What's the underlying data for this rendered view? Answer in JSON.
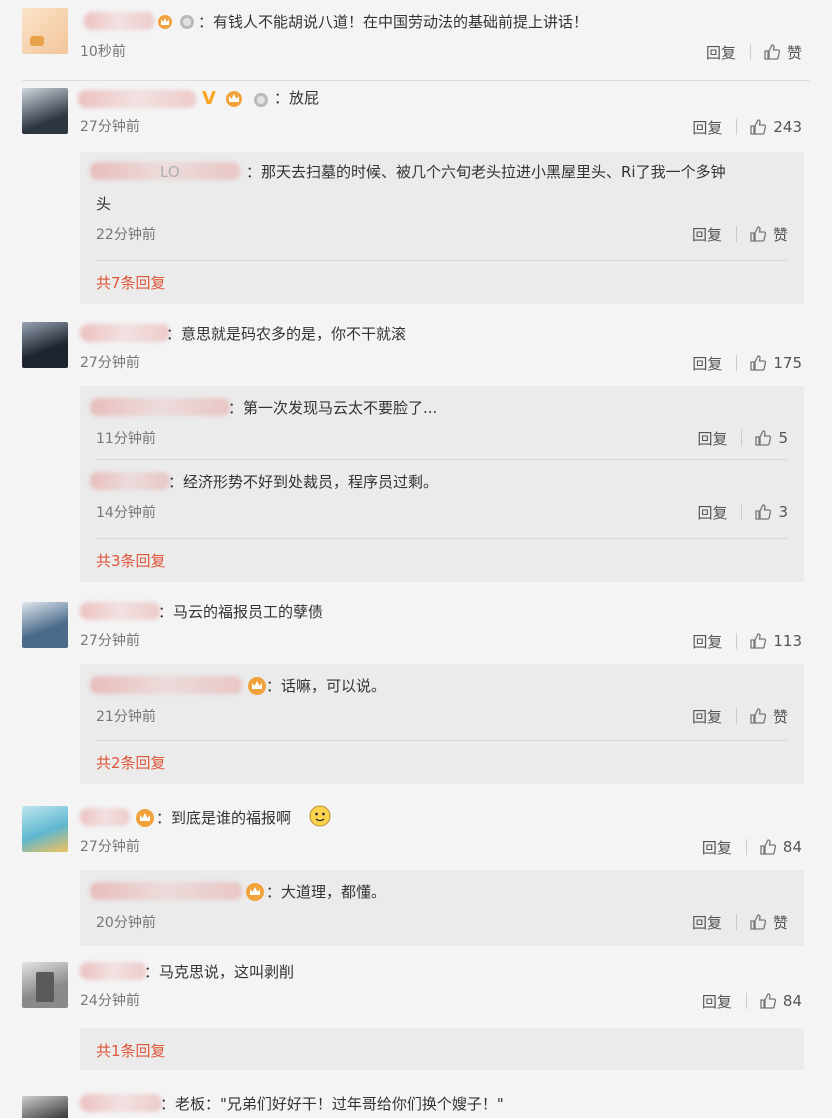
{
  "ui": {
    "reply_label": "回复",
    "like_label": "赞"
  },
  "comments": [
    {
      "text": "：有钱人不能胡说八道！在中国劳动法的基础前提上讲话！",
      "time": "10秒前",
      "likes": "赞"
    },
    {
      "text": "：放屁",
      "time": "27分钟前",
      "likes": "243",
      "replies": [
        {
          "text": "：那天去扫墓的时候、被几个六旬老头拉进小黑屋里头、Ri了我一个多钟",
          "text2": "头",
          "name_fragment": "LO",
          "time": "22分钟前",
          "likes": "赞"
        }
      ],
      "more": "共7条回复"
    },
    {
      "text": "：意思就是码农多的是，你不干就滚",
      "time": "27分钟前",
      "likes": "175",
      "replies": [
        {
          "text": "：第一次发现马云太不要脸了...",
          "time": "11分钟前",
          "likes": "5"
        },
        {
          "text": "：经济形势不好到处裁员，程序员过剩。",
          "time": "14分钟前",
          "likes": "3"
        }
      ],
      "more": "共3条回复"
    },
    {
      "text": "：马云的福报员工的孽债",
      "time": "27分钟前",
      "likes": "113",
      "replies": [
        {
          "text": "：话嘛，可以说。",
          "time": "21分钟前",
          "likes": "赞"
        }
      ],
      "more": "共2条回复"
    },
    {
      "text": "：到底是谁的福报啊",
      "time": "27分钟前",
      "likes": "84",
      "replies": [
        {
          "text": "：大道理，都懂。",
          "time": "20分钟前",
          "likes": "赞"
        }
      ]
    },
    {
      "text": "：马克思说，这叫剥削",
      "time": "24分钟前",
      "likes": "84",
      "more": "共1条回复"
    },
    {
      "text": "：老板：\"兄弟们好好干！过年哥给你们换个嫂子！\""
    }
  ]
}
